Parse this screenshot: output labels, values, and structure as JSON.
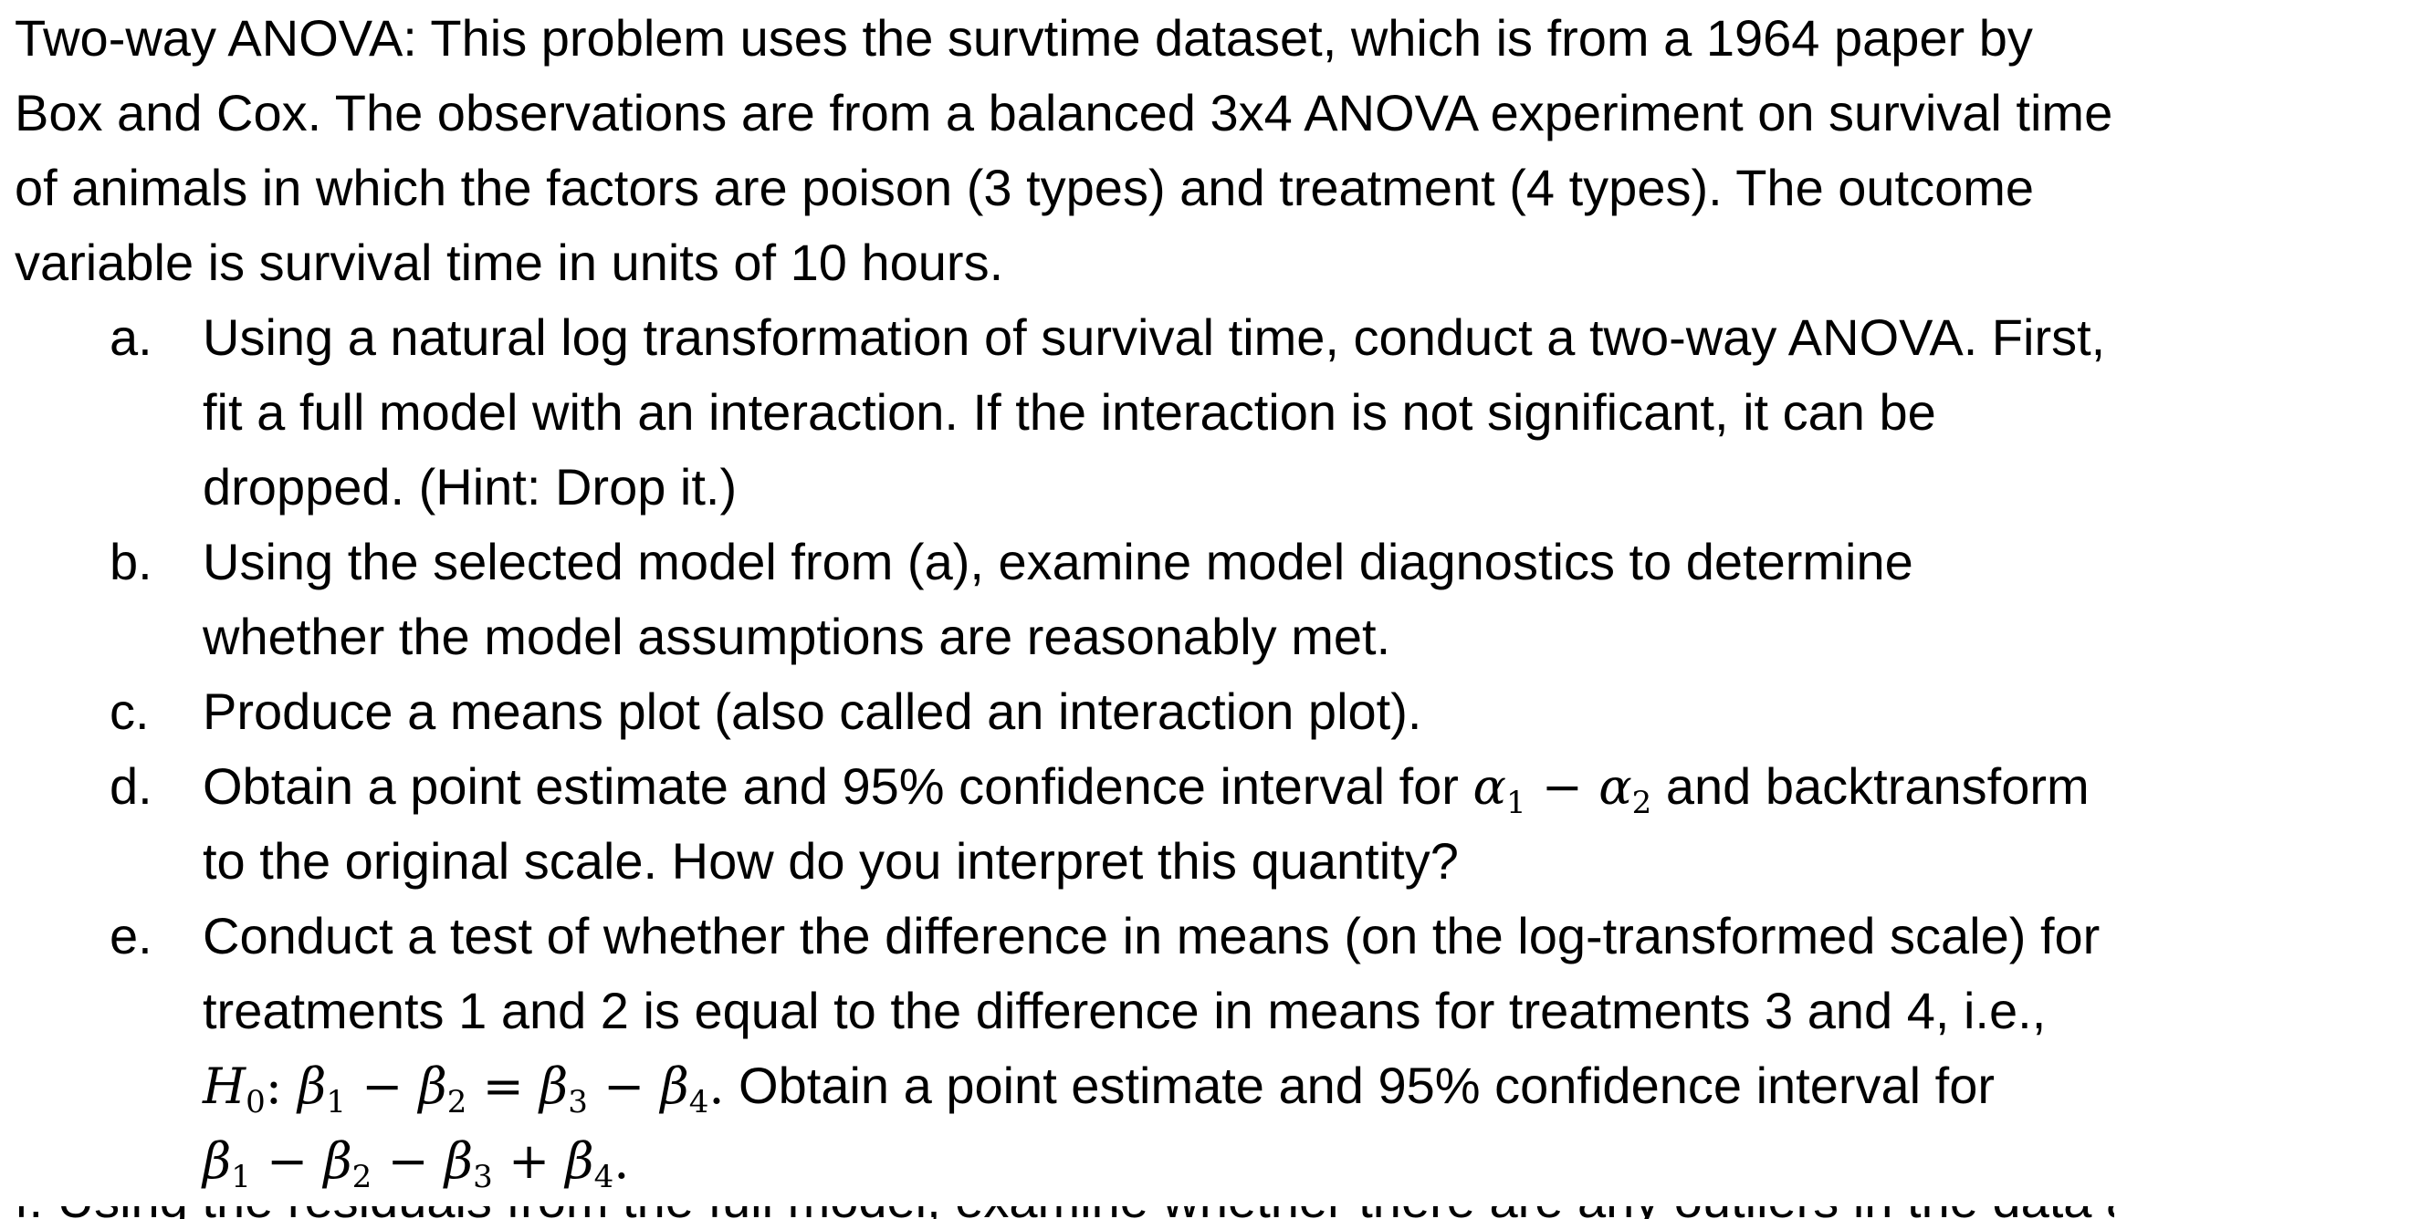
{
  "intro": [
    "Two-way ANOVA: This problem uses the survtime dataset, which is from a 1964 paper by",
    "Box and Cox. The observations are from a balanced 3x4 ANOVA experiment on survival time",
    "of animals in which the factors are poison (3 types) and treatment (4 types).  The outcome",
    "variable is survival time in units of 10 hours."
  ],
  "items": {
    "a": {
      "marker": "a.",
      "lines": [
        "Using a natural log transformation of survival time, conduct a two-way ANOVA. First,",
        "fit a full model with an interaction. If the interaction is not significant, it can be",
        "dropped. (Hint: Drop it.)"
      ]
    },
    "b": {
      "marker": "b.",
      "lines": [
        "Using the selected model from (a), examine model diagnostics to determine",
        "whether the model assumptions are reasonably met."
      ]
    },
    "c": {
      "marker": "c.",
      "lines": [
        "Produce a means plot (also called an interaction plot)."
      ]
    },
    "d": {
      "marker": "d.",
      "line1_before": "Obtain a point estimate and 95% confidence interval for ",
      "line1_after": " and backtransform",
      "line2": "to the original scale. How do you interpret this quantity?"
    },
    "e": {
      "marker": "e.",
      "line1": "Conduct a test of whether the difference in means (on the log-transformed scale) for",
      "line2": "treatments 1 and 2 is equal to the difference in means for treatments 3 and 4, i.e.,",
      "line3_after": " Obtain a point estimate and 95% confidence interval for"
    }
  },
  "truncated_next_line": "f.   Using the residuals from the full model, examine whether there are any outliers in the data and discuss"
}
